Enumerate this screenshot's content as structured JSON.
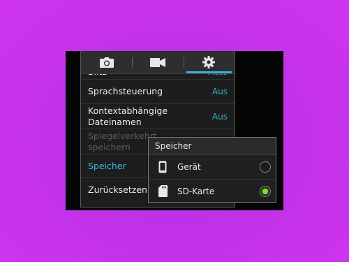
{
  "tabs": [
    {
      "name": "camera",
      "icon": "camera-icon"
    },
    {
      "name": "video",
      "icon": "video-camera-icon"
    },
    {
      "name": "settings",
      "icon": "gear-icon",
      "active": true
    }
  ],
  "settings": {
    "rows": [
      {
        "label": "Blitz",
        "value": "Auto"
      },
      {
        "label": "Sprachsteuerung",
        "value": "Aus"
      },
      {
        "label_line1": "Kontextabhängige",
        "label_line2": "Dateinamen",
        "value": "Aus"
      },
      {
        "label_line1": "Spiegelverkehrt",
        "label_line2": "speichern",
        "state": "disabled"
      },
      {
        "label": "Speicher",
        "state": "highlighted"
      },
      {
        "label": "Zurücksetzen"
      }
    ]
  },
  "dialog": {
    "title": "Speicher",
    "options": [
      {
        "label": "Gerät",
        "icon": "phone-icon",
        "selected": false
      },
      {
        "label": "SD-Karte",
        "icon": "sd-card-icon",
        "selected": true
      }
    ]
  },
  "colors": {
    "background": "#c132e8",
    "accent": "#37b0de",
    "radio_selected": "#7ddd2e"
  }
}
